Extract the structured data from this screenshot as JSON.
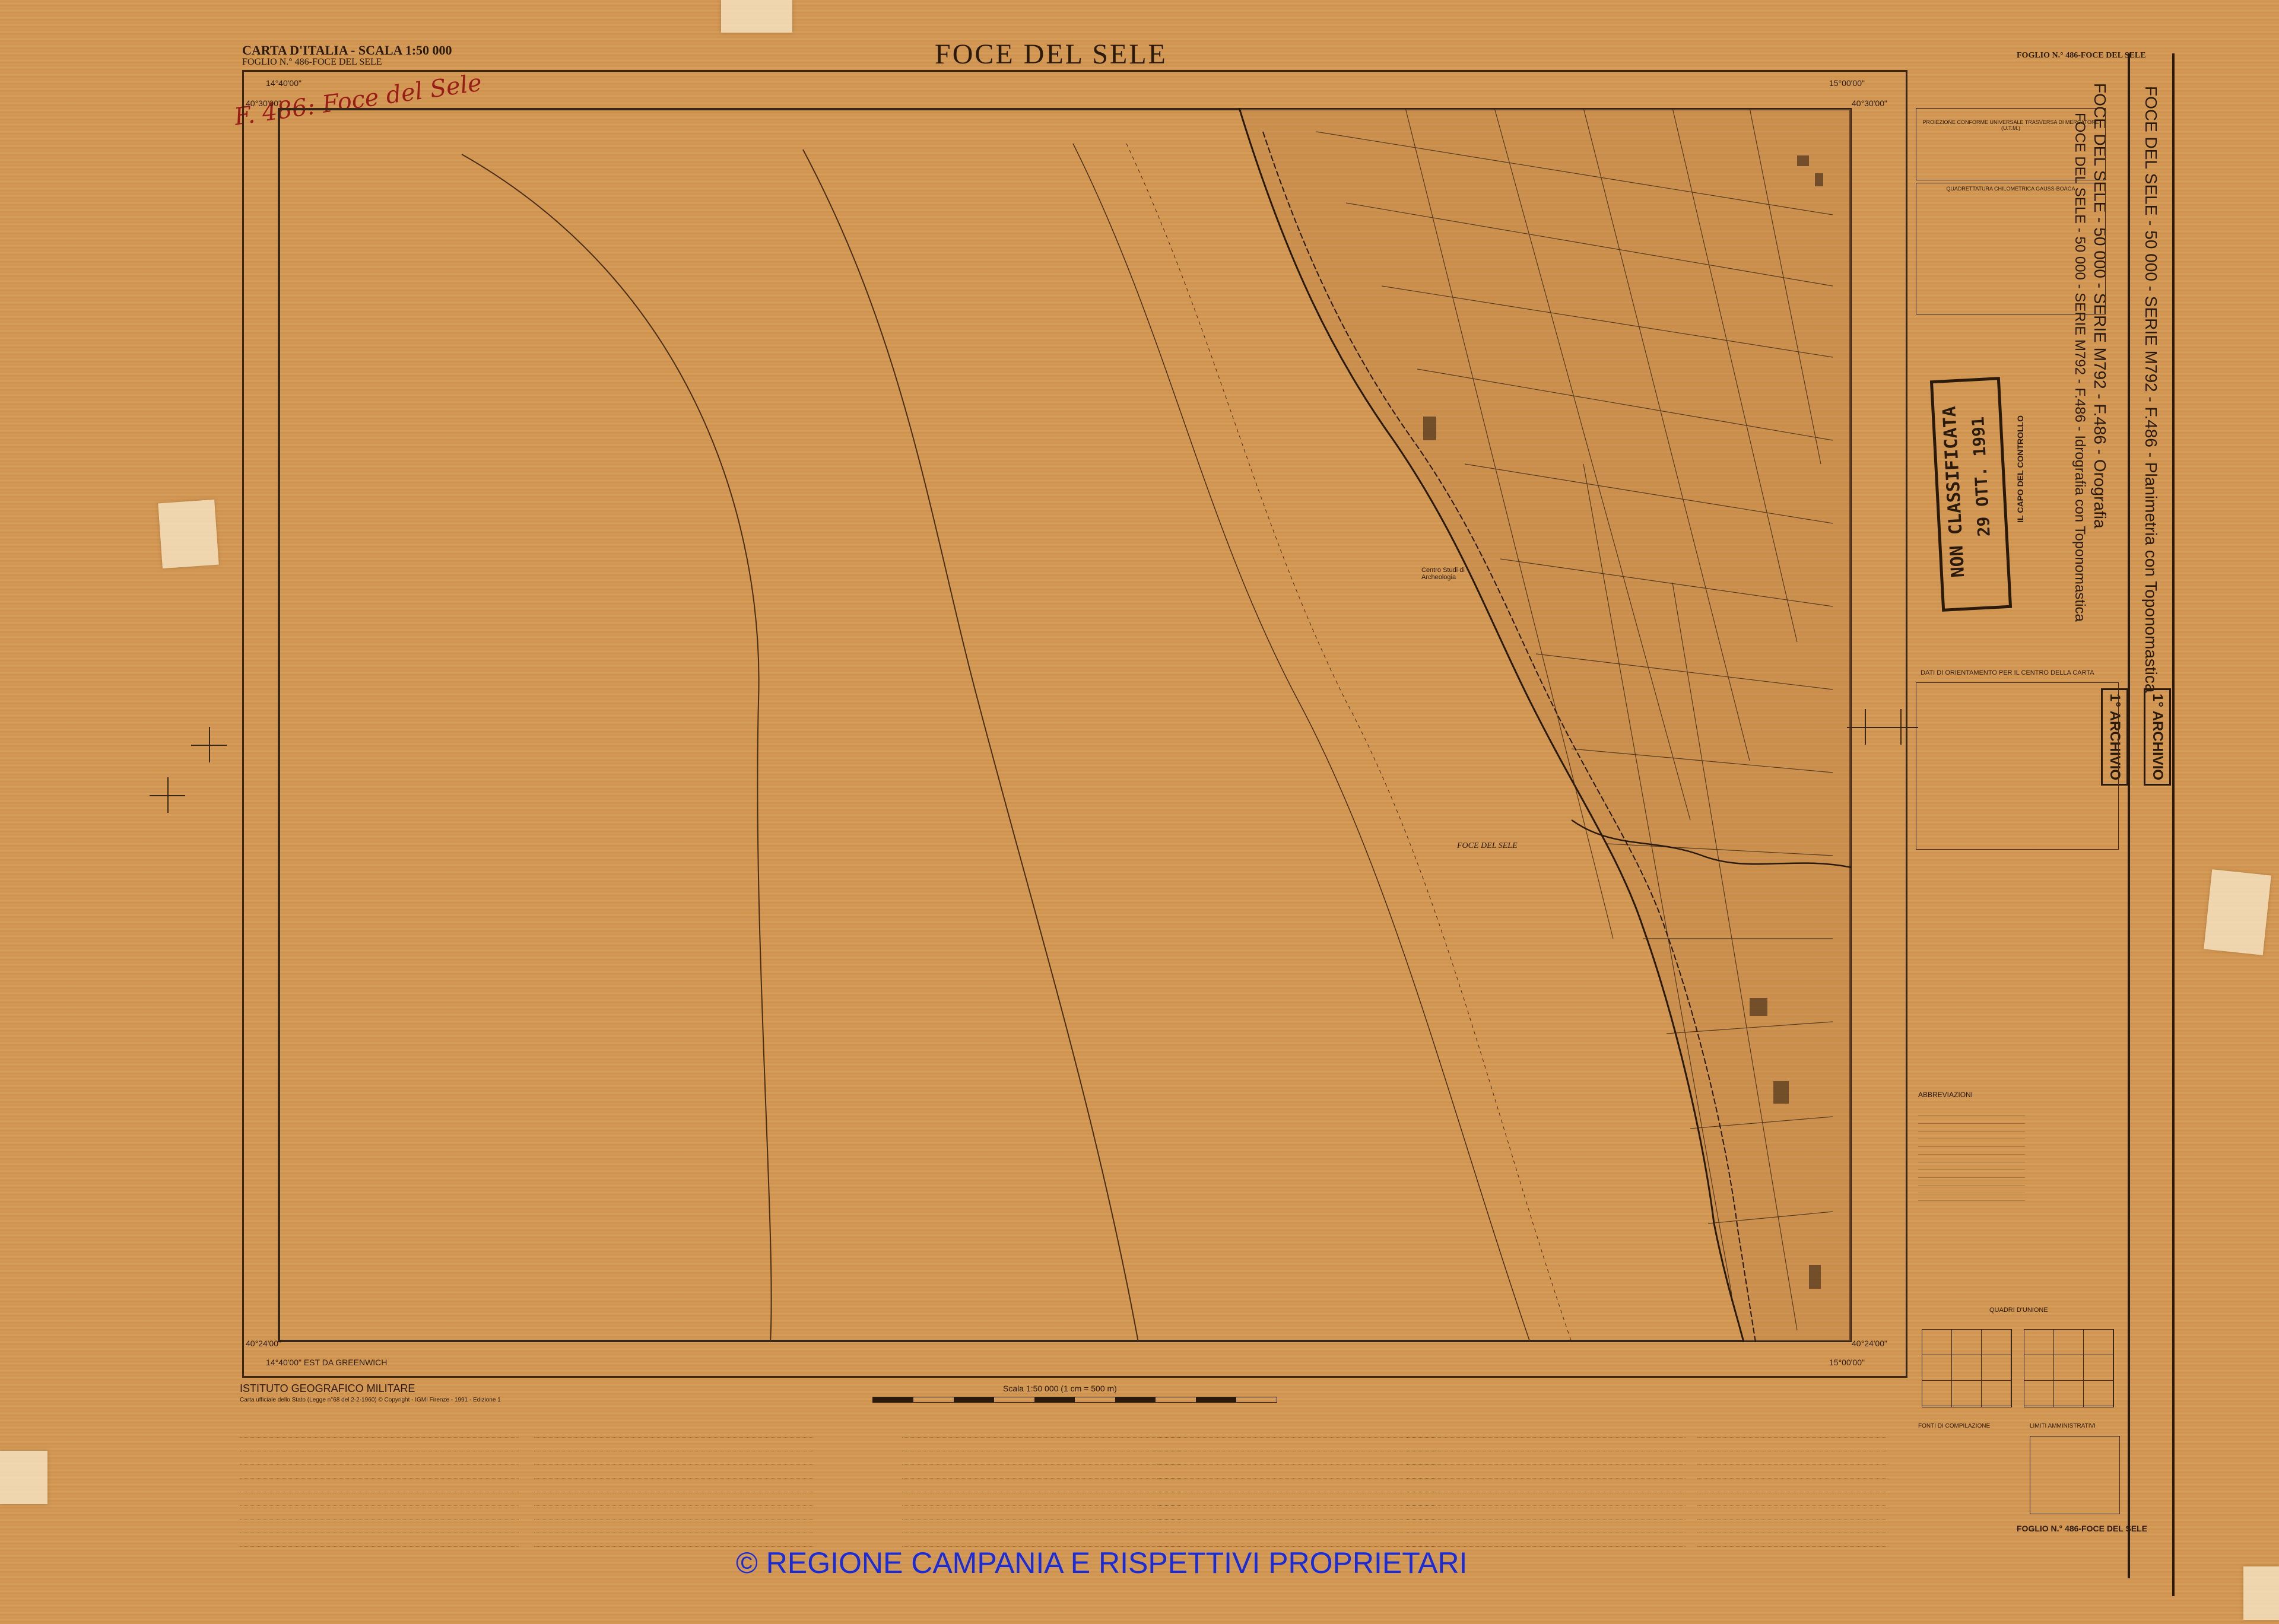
{
  "header": {
    "series_line": "CARTA D'ITALIA - SCALA 1:50 000",
    "sheet_line": "FOGLIO N.° 486-FOCE DEL SELE",
    "main_title": "FOCE DEL SELE",
    "top_right_sheet": "FOGLIO N.° 486-FOCE DEL SELE",
    "handwritten_note": "F. 486: Foce del Sele"
  },
  "coords": {
    "top_left_lon": "14°40'00\"",
    "top_left_lat": "40°30'00\"",
    "top_right_lon": "15°00'00\"",
    "top_right_lat": "40°30'00\"",
    "bottom_left_lat": "40°24'00\"",
    "bottom_left_lon": "14°40'00\" EST DA GREENWICH",
    "bottom_right_lat": "40°24'00\"",
    "bottom_right_lon": "15°00'00\""
  },
  "map": {
    "river_label": "FOCE DEL SELE",
    "place_label": "Centro Studi di Archeologia"
  },
  "footer": {
    "publisher": "ISTITUTO GEOGRAFICO MILITARE",
    "publisher_note": "Carta ufficiale dello Stato (Legge n°68 del 2-2-1960) © Copyright - IGMI Firenze - 1991 - Edizione 1",
    "scale_label": "Scala 1:50 000 (1 cm = 500 m)",
    "bottom_right_sheet": "FOGLIO N.° 486-FOCE DEL SELE",
    "copyright": "© REGIONE CAMPANIA E RISPETTIVI PROPRIETARI"
  },
  "side_panel": {
    "vertical_title_1": "FOCE DEL SELE - 50 000 - SERIE M792 - F.486 - Orografia",
    "vertical_title_2": "FOCE DEL SELE - 50 000 - SERIE M792 - F.486 - Planimetria con Toponomastica",
    "vertical_title_3": "FOCE DEL SELE - 50 000 - SERIE M792 - F.486 - Idrografia con Toponomastica",
    "stamp_main": "NON CLASSIFICATA",
    "stamp_date": "29 OTT. 1991",
    "stamp_sub": "IL CAPO DEL CONTROLLO",
    "archive_label": "1° ARCHIVIO",
    "projection_title": "PROIEZIONE CONFORME UNIVERSALE TRASVERSA DI MERCATORE (U.T.M.)",
    "grid_title": "QUADRETTATURA CHILOMETRICA GAUSS-BOAGA",
    "orientation_title": "DATI DI ORIENTAMENTO PER IL CENTRO DELLA CARTA",
    "abbreviations_title": "ABBREVIAZIONI",
    "junction_title": "QUADRI D'UNIONE",
    "compilation_title": "FONTI DI COMPILAZIONE",
    "admin_title": "LIMITI AMMINISTRATIVI"
  },
  "colors": {
    "paper": "#d49a55",
    "ink": "#2a1a0c",
    "copyright_blue": "#1a2bd8"
  }
}
